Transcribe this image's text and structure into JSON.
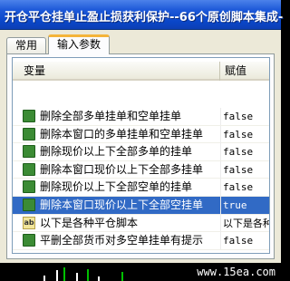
{
  "window": {
    "title": "开仓平仓挂单止盈止损获利保护--66个原创脚本集成-"
  },
  "tabs": [
    {
      "label": "常用",
      "active": false
    },
    {
      "label": "输入参数",
      "active": true
    }
  ],
  "table": {
    "headers": {
      "variable": "变量",
      "value": "赋值"
    },
    "rows": [
      {
        "icon": "bool-icon",
        "name": "删除全部多单挂单和空单挂单",
        "value": "false",
        "selected": false
      },
      {
        "icon": "bool-icon",
        "name": "删除本窗口的多单挂单和空单挂单",
        "value": "false",
        "selected": false
      },
      {
        "icon": "bool-icon",
        "name": "删除现价以上下全部多单的挂单",
        "value": "false",
        "selected": false
      },
      {
        "icon": "bool-icon",
        "name": "删除本窗口现价以上下全部多挂单",
        "value": "false",
        "selected": false
      },
      {
        "icon": "bool-icon",
        "name": "删除现价以上下全部空单的挂单",
        "value": "false",
        "selected": false
      },
      {
        "icon": "bool-icon",
        "name": "删除本窗口现价以上下全部空挂单",
        "value": "true",
        "selected": true
      },
      {
        "icon": "string-icon",
        "name": "以下是各种平仓脚本",
        "value": "以下是各种平",
        "selected": false
      },
      {
        "icon": "bool-icon",
        "name": "平删全部货币对多空单挂单有提示",
        "value": "false",
        "selected": false
      }
    ]
  },
  "footer": {
    "watermark": "www.15ea.com"
  },
  "colors": {
    "titlebar": "#0a46c8",
    "selection": "#316ac5",
    "active_tab_accent": "#f4b43a"
  }
}
